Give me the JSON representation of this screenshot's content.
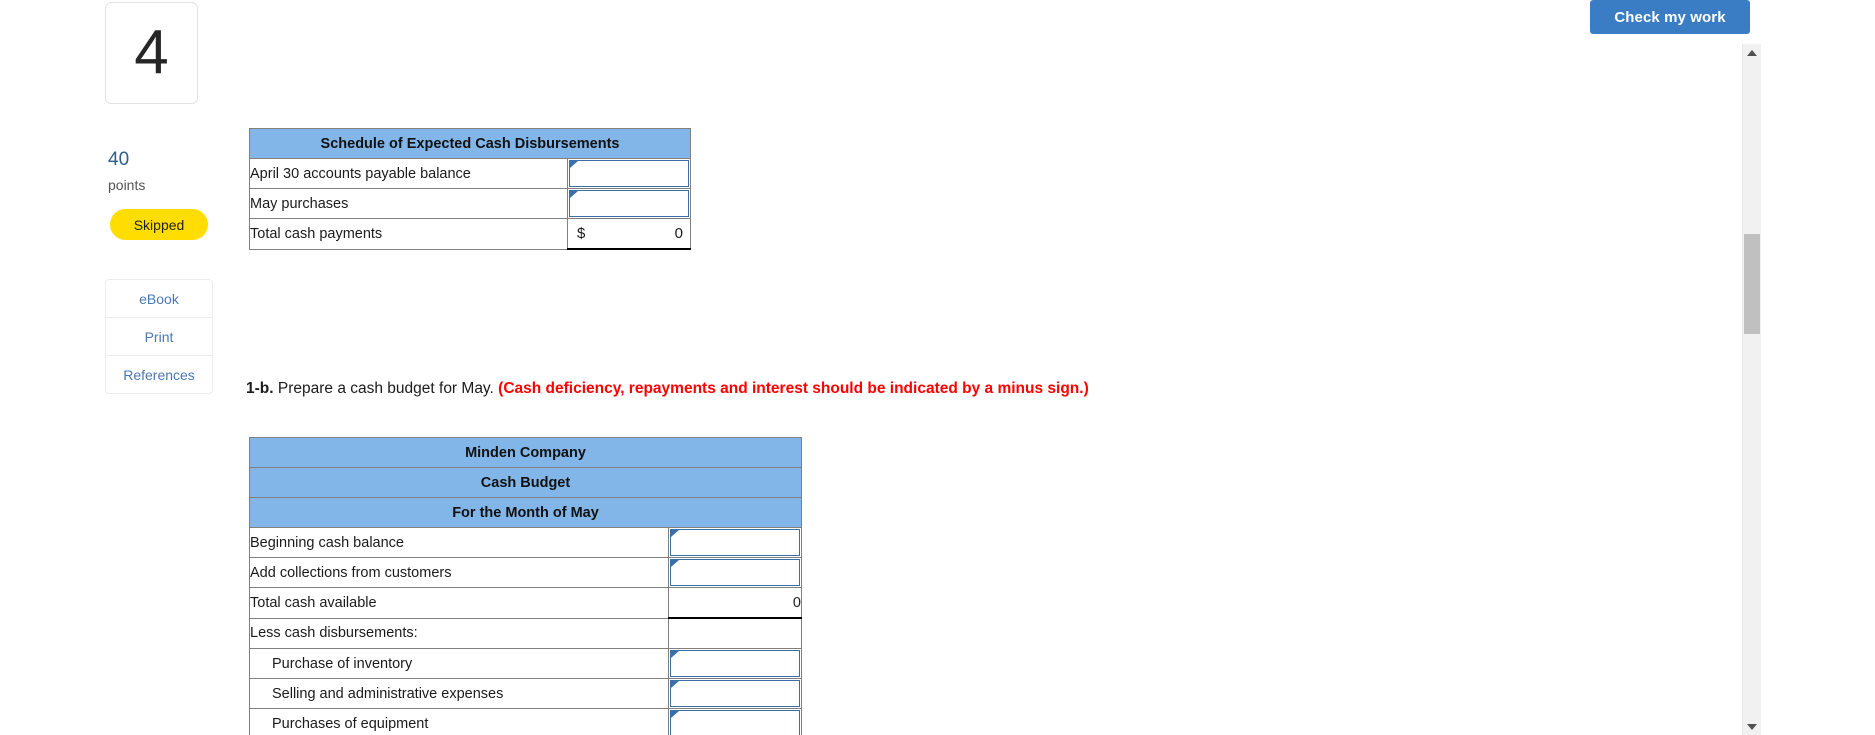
{
  "toolbar": {
    "check_my_work_label": "Check my work"
  },
  "question_rail": {
    "question_number": "4",
    "points_value": "40",
    "points_label": "points",
    "status_badge": "Skipped",
    "links": [
      {
        "label": "eBook"
      },
      {
        "label": "Print"
      },
      {
        "label": "References"
      }
    ]
  },
  "scrollbar": {
    "up_arrow_icon": "triangle-up-icon",
    "down_arrow_icon": "triangle-down-icon"
  },
  "schedule_table": {
    "title": "Schedule of Expected Cash Disbursements",
    "rows": [
      {
        "label": "April 30 accounts payable balance",
        "type": "input",
        "value": ""
      },
      {
        "label": "May purchases",
        "type": "input",
        "value": ""
      },
      {
        "label": "Total cash payments",
        "type": "total",
        "currency": "$",
        "value": "0"
      }
    ]
  },
  "prompt_1b": {
    "tag": "1-b.",
    "text": " Prepare a cash budget for May. ",
    "note": "(Cash deficiency, repayments and interest should be indicated by a minus sign.)"
  },
  "cash_budget_table": {
    "headers": [
      "Minden Company",
      "Cash Budget",
      "For the Month of May"
    ],
    "rows": [
      {
        "label": "Beginning cash balance",
        "type": "input",
        "value": "",
        "indent": false
      },
      {
        "label": "Add collections from customers",
        "type": "input",
        "value": "",
        "indent": false
      },
      {
        "label": "Total cash available",
        "type": "total_plain",
        "value": "0",
        "indent": false
      },
      {
        "label": "Less cash disbursements:",
        "type": "blank",
        "value": "",
        "indent": false
      },
      {
        "label": "Purchase of inventory",
        "type": "input",
        "value": "",
        "indent": true
      },
      {
        "label": "Selling and administrative expenses",
        "type": "input",
        "value": "",
        "indent": true
      },
      {
        "label": "Purchases of equipment",
        "type": "input",
        "value": "",
        "indent": true
      }
    ]
  }
}
